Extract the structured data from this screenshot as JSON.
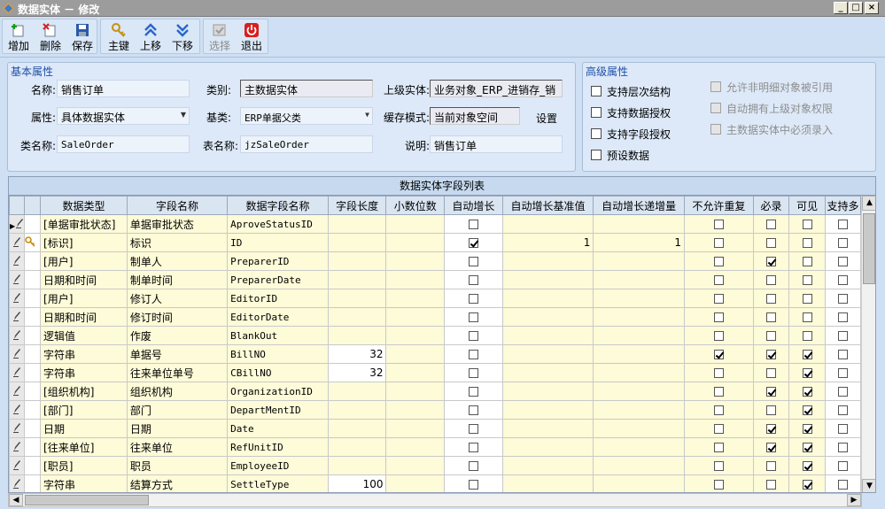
{
  "window": {
    "title": "数据实体 － 修改",
    "min": "_",
    "max": "□",
    "close": "×"
  },
  "toolbar": {
    "add": "增加",
    "delete": "删除",
    "save": "保存",
    "primary_key": "主键",
    "move_up": "上移",
    "move_down": "下移",
    "select": "选择",
    "exit": "退出"
  },
  "basic": {
    "title": "基本属性",
    "name_label": "名称:",
    "name_value": "销售订单",
    "category_label": "类别:",
    "category_value": "主数据实体",
    "parent_label": "上级实体:",
    "parent_value": "业务对象_ERP_进销存_销",
    "attr_label": "属性:",
    "attr_value": "具体数据实体",
    "base_label": "基类:",
    "base_value": "ERP单据父类",
    "cache_label": "缓存模式:",
    "cache_value": "当前对象空间",
    "settings_label": "设置",
    "class_label": "类名称:",
    "class_value": "SaleOrder",
    "table_label": "表名称:",
    "table_value": "jzSaleOrder",
    "desc_label": "说明:",
    "desc_value": "销售订单"
  },
  "advanced": {
    "title": "高级属性",
    "opt1": "支持层次结构",
    "opt2": "支持数据授权",
    "opt3": "支持字段授权",
    "opt4": "预设数据",
    "opt5": "允许非明细对象被引用",
    "opt6": "自动拥有上级对象权限",
    "opt7": "主数据实体中必须录入"
  },
  "grid": {
    "caption": "数据实体字段列表",
    "headers": [
      "数据类型",
      "字段名称",
      "数据字段名称",
      "字段长度",
      "小数位数",
      "自动增长",
      "自动增长基准值",
      "自动增长递增量",
      "不允许重复",
      "必录",
      "可见",
      "支持多"
    ],
    "rows": [
      {
        "type": "[单据审批状态]",
        "name": "单据审批状态",
        "field": "AproveStatusID",
        "len": "",
        "dec": "",
        "auto": false,
        "base": "",
        "inc": "",
        "uniq": false,
        "req": false,
        "vis": false,
        "key": false,
        "current": true
      },
      {
        "type": "[标识]",
        "name": "标识",
        "field": "ID",
        "len": "",
        "dec": "",
        "auto": true,
        "base": "1",
        "inc": "1",
        "uniq": false,
        "req": false,
        "vis": false,
        "key": true,
        "current": false
      },
      {
        "type": "[用户]",
        "name": "制单人",
        "field": "PreparerID",
        "len": "",
        "dec": "",
        "auto": false,
        "base": "",
        "inc": "",
        "uniq": false,
        "req": true,
        "vis": false,
        "key": false,
        "current": false
      },
      {
        "type": "日期和时间",
        "name": "制单时间",
        "field": "PreparerDate",
        "len": "",
        "dec": "",
        "auto": false,
        "base": "",
        "inc": "",
        "uniq": false,
        "req": false,
        "vis": false,
        "key": false,
        "current": false
      },
      {
        "type": "[用户]",
        "name": "修订人",
        "field": "EditorID",
        "len": "",
        "dec": "",
        "auto": false,
        "base": "",
        "inc": "",
        "uniq": false,
        "req": false,
        "vis": false,
        "key": false,
        "current": false
      },
      {
        "type": "日期和时间",
        "name": "修订时间",
        "field": "EditorDate",
        "len": "",
        "dec": "",
        "auto": false,
        "base": "",
        "inc": "",
        "uniq": false,
        "req": false,
        "vis": false,
        "key": false,
        "current": false
      },
      {
        "type": "逻辑值",
        "name": "作废",
        "field": "BlankOut",
        "len": "",
        "dec": "",
        "auto": false,
        "base": "",
        "inc": "",
        "uniq": false,
        "req": false,
        "vis": false,
        "key": false,
        "current": false
      },
      {
        "type": "字符串",
        "name": "单据号",
        "field": "BillNO",
        "len": "32",
        "dec": "",
        "auto": false,
        "base": "",
        "inc": "",
        "uniq": true,
        "req": true,
        "vis": true,
        "key": false,
        "current": false
      },
      {
        "type": "字符串",
        "name": "往来单位单号",
        "field": "CBillNO",
        "len": "32",
        "dec": "",
        "auto": false,
        "base": "",
        "inc": "",
        "uniq": false,
        "req": false,
        "vis": true,
        "key": false,
        "current": false
      },
      {
        "type": "[组织机构]",
        "name": "组织机构",
        "field": "OrganizationID",
        "len": "",
        "dec": "",
        "auto": false,
        "base": "",
        "inc": "",
        "uniq": false,
        "req": true,
        "vis": true,
        "key": false,
        "current": false
      },
      {
        "type": "[部门]",
        "name": "部门",
        "field": "DepartMentID",
        "len": "",
        "dec": "",
        "auto": false,
        "base": "",
        "inc": "",
        "uniq": false,
        "req": false,
        "vis": true,
        "key": false,
        "current": false
      },
      {
        "type": "日期",
        "name": "日期",
        "field": "Date",
        "len": "",
        "dec": "",
        "auto": false,
        "base": "",
        "inc": "",
        "uniq": false,
        "req": true,
        "vis": true,
        "key": false,
        "current": false
      },
      {
        "type": "[往来单位]",
        "name": "往来单位",
        "field": "RefUnitID",
        "len": "",
        "dec": "",
        "auto": false,
        "base": "",
        "inc": "",
        "uniq": false,
        "req": true,
        "vis": true,
        "key": false,
        "current": false
      },
      {
        "type": "[职员]",
        "name": "职员",
        "field": "EmployeeID",
        "len": "",
        "dec": "",
        "auto": false,
        "base": "",
        "inc": "",
        "uniq": false,
        "req": false,
        "vis": true,
        "key": false,
        "current": false
      },
      {
        "type": "字符串",
        "name": "结算方式",
        "field": "SettleType",
        "len": "100",
        "dec": "",
        "auto": false,
        "base": "",
        "inc": "",
        "uniq": false,
        "req": false,
        "vis": true,
        "key": false,
        "current": false
      }
    ]
  },
  "colors": {
    "accent": "#1f4fa8",
    "grid_cell": "#fdfbd8",
    "title_bar": "#9c9c9c"
  }
}
